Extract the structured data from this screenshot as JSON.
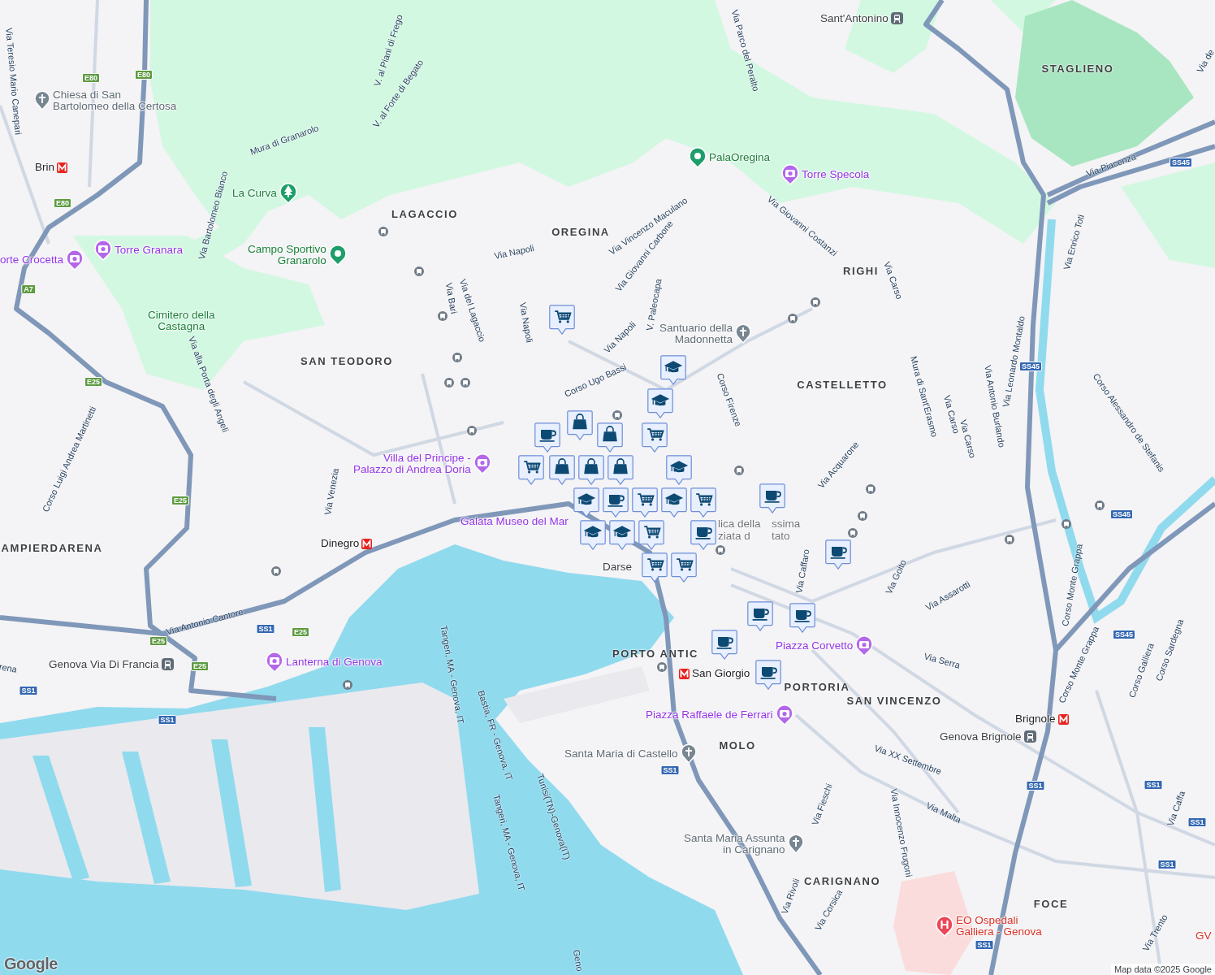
{
  "map": {
    "districts": [
      "STAGLIENO",
      "LAGACCIO",
      "OREGINA",
      "RIGHI",
      "SAN TEODORO",
      "CASTELLETTO",
      "AMPIERDARENA",
      "PORTO ANTIC",
      "PORTORIA",
      "SAN VINCENZO",
      "MOLO",
      "CARIGNANO",
      "FOCE"
    ],
    "places": [
      {
        "label": "Chiesa di San\nBartolomeo della Certosa",
        "kind": "church"
      },
      {
        "label": "Brin",
        "kind": "metro"
      },
      {
        "label": "La Curva",
        "kind": "park"
      },
      {
        "label": "Torre Granara",
        "kind": "attraction"
      },
      {
        "label": "orte Crocetta",
        "kind": "attraction"
      },
      {
        "label": "Campo Sportivo\nGranarolo",
        "kind": "sport"
      },
      {
        "label": "Cimitero della\nCastagna",
        "kind": "green-text"
      },
      {
        "label": "Sant'Antonino",
        "kind": "station"
      },
      {
        "label": "PalaOregina",
        "kind": "sport"
      },
      {
        "label": "Torre Specola",
        "kind": "attraction"
      },
      {
        "label": "Santuario della\nMadonnetta",
        "kind": "church"
      },
      {
        "label": "Villa del Principe -\nPalazzo di Andrea Doria",
        "kind": "attraction"
      },
      {
        "label": "Galata Museo del Mar",
        "kind": "attraction-text"
      },
      {
        "label": "Dinegro",
        "kind": "metro"
      },
      {
        "label": "Darse",
        "kind": "plain"
      },
      {
        "label": "Piazza Corvetto",
        "kind": "attraction"
      },
      {
        "label": "Lanterna di Genova",
        "kind": "attraction"
      },
      {
        "label": "Genova Via Di Francia",
        "kind": "station"
      },
      {
        "label": "San Giorgio",
        "kind": "metro"
      },
      {
        "label": "Piazza Raffaele de Ferrari",
        "kind": "attraction"
      },
      {
        "label": "Santa Maria di Castello",
        "kind": "church"
      },
      {
        "label": "Santa Maria Assunta\nin Carignano",
        "kind": "church"
      },
      {
        "label": "Brignole",
        "kind": "metro"
      },
      {
        "label": "Genova Brignole",
        "kind": "station"
      },
      {
        "label": "EO Ospedali\nGalliera - Genova",
        "kind": "hospital"
      },
      {
        "label": "GV",
        "kind": "hospital-text"
      },
      {
        "label": "lica della",
        "kind": "church-text"
      },
      {
        "label": "ssima",
        "kind": "church-text"
      },
      {
        "label": "ziata d",
        "kind": "church-text"
      },
      {
        "label": "tato",
        "kind": "church-text"
      }
    ],
    "streets": [
      "Via Teresio Mario Canepari",
      "Mura di Granarolo",
      "Via Bartolomeo Bianco",
      "V. al Piani di Frego",
      "V. al Forte di Begato",
      "Via Napoli",
      "Via Vincenzo Maculano",
      "Via Giovanni Carbone",
      "V. Paleocapa",
      "Via Napoli",
      "Via Napoli",
      "Corso Ugo Bassi",
      "Via Bari",
      "Via del Lagaccio",
      "Via Parco del Peralto",
      "Via Giovanni Costanzi",
      "Via Carso",
      "Via Piacenza",
      "Via Enrico Toti",
      "Via Leonardo Montaldo",
      "Via Antonio Burlando",
      "Corso Alessandro de Stefanis",
      "Mura di Sant'Erasmo",
      "Via Carso",
      "Via Carso",
      "Corso Firenze",
      "Via Acquarone",
      "Via Caffaro",
      "Via Goito",
      "Via Assarotti",
      "Via Serra",
      "Corso Monte Grappa",
      "Corso Monte Grappa",
      "Corso Galliera",
      "Corso Sardegna",
      "Via XX Settembre",
      "Via Fieschi",
      "Via Innocenzo Frugoni",
      "Via Malta",
      "Via Caffa",
      "Via Rivoli",
      "Via Corsica",
      "Via Trento",
      "Via Antonio Cantore",
      "Via Venezia",
      "Corso Luigi Andrea Martinetti",
      "Via alla Porta degli Angeli",
      "Tangeri, MA - Genova, IT",
      "Bastia, FR - Genova, IT",
      "Tunisi(TN)-Genova(IT)",
      "Tangeri, MA - Genova, IT",
      "rena",
      "Via de",
      "Geno"
    ],
    "road_shields": [
      {
        "label": "E80",
        "kind": "european"
      },
      {
        "label": "E80",
        "kind": "european"
      },
      {
        "label": "E80",
        "kind": "european"
      },
      {
        "label": "A7",
        "kind": "european"
      },
      {
        "label": "E25",
        "kind": "european"
      },
      {
        "label": "E25",
        "kind": "european"
      },
      {
        "label": "E25",
        "kind": "european"
      },
      {
        "label": "E25",
        "kind": "european"
      },
      {
        "label": "E25",
        "kind": "european"
      },
      {
        "label": "SS1",
        "kind": "state"
      },
      {
        "label": "SS1",
        "kind": "state"
      },
      {
        "label": "SS1",
        "kind": "state"
      },
      {
        "label": "SS1",
        "kind": "state"
      },
      {
        "label": "SS1",
        "kind": "state"
      },
      {
        "label": "SS1",
        "kind": "state"
      },
      {
        "label": "SS1",
        "kind": "state"
      },
      {
        "label": "SS1",
        "kind": "state"
      },
      {
        "label": "SS1",
        "kind": "state"
      },
      {
        "label": "SS45",
        "kind": "state"
      },
      {
        "label": "SS45",
        "kind": "state"
      },
      {
        "label": "SS45",
        "kind": "state"
      },
      {
        "label": "SS45",
        "kind": "state"
      }
    ],
    "markers": [
      {
        "kind": "cart"
      },
      {
        "kind": "cap"
      },
      {
        "kind": "cap"
      },
      {
        "kind": "cart"
      },
      {
        "kind": "cup"
      },
      {
        "kind": "bag"
      },
      {
        "kind": "bag"
      },
      {
        "kind": "cart"
      },
      {
        "kind": "bag"
      },
      {
        "kind": "bag"
      },
      {
        "kind": "bag"
      },
      {
        "kind": "cap"
      },
      {
        "kind": "cap"
      },
      {
        "kind": "cup"
      },
      {
        "kind": "cart"
      },
      {
        "kind": "cap"
      },
      {
        "kind": "cart"
      },
      {
        "kind": "cap"
      },
      {
        "kind": "cap"
      },
      {
        "kind": "cart"
      },
      {
        "kind": "cup"
      },
      {
        "kind": "cart"
      },
      {
        "kind": "cart"
      },
      {
        "kind": "cup"
      },
      {
        "kind": "cup"
      },
      {
        "kind": "cup"
      },
      {
        "kind": "cup"
      },
      {
        "kind": "cup"
      },
      {
        "kind": "cup"
      }
    ],
    "logo": "Google",
    "attribution": "Map data ©2025 Google"
  }
}
